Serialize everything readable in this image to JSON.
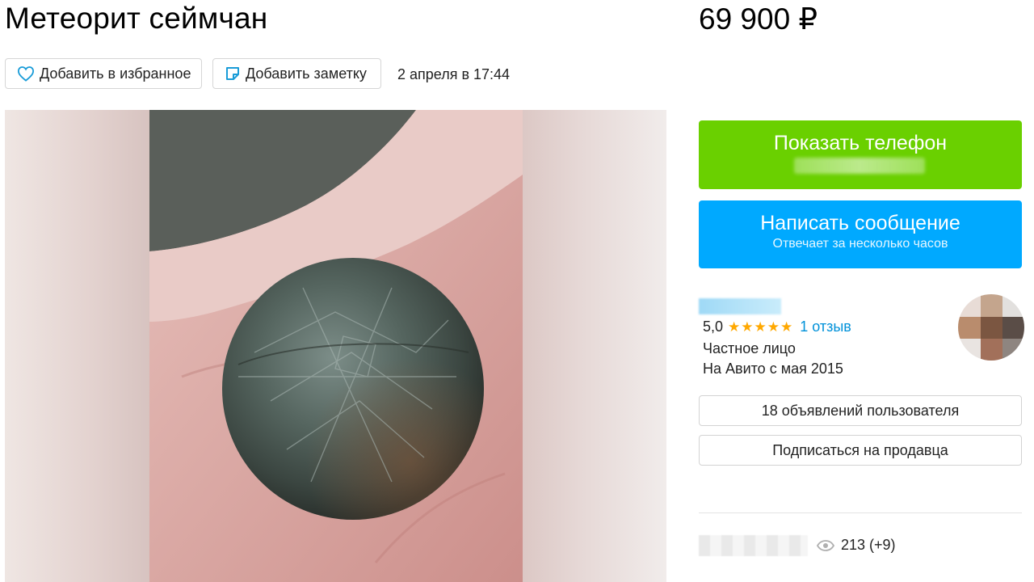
{
  "listing": {
    "title": "Метеорит сеймчан",
    "price": "69 900 ₽",
    "date": "2 апреля в 17:44"
  },
  "actions": {
    "favorite_label": "Добавить в избранное",
    "note_label": "Добавить заметку"
  },
  "contact": {
    "show_phone_label": "Показать телефон",
    "message_label": "Написать сообщение",
    "message_sub": "Отвечает за несколько часов"
  },
  "seller": {
    "rating": "5,0",
    "stars": "★★★★★",
    "reviews": "1 отзыв",
    "type": "Частное лицо",
    "since": "На Авито с мая 2015",
    "listings_button": "18 объявлений пользователя",
    "subscribe_button": "Подписаться на продавца"
  },
  "stats": {
    "views": "213 (+9)"
  },
  "colors": {
    "phone_button": "#6ad000",
    "message_button": "#00a9ff",
    "link": "#0091d9",
    "star": "#ffa800",
    "icon_blue": "#1a9cd8"
  }
}
